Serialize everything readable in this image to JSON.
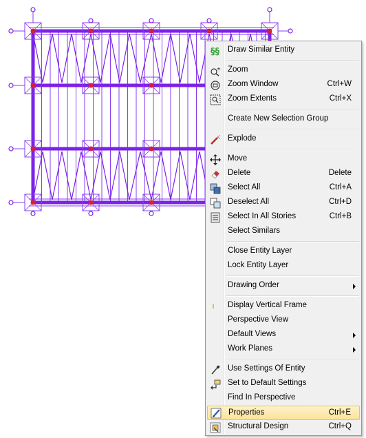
{
  "menu": {
    "draw_similar": "Draw Similar Entity",
    "zoom": "Zoom",
    "zoom_window": "Zoom Window",
    "zoom_window_sc": "Ctrl+W",
    "zoom_extents": "Zoom Extents",
    "zoom_extents_sc": "Ctrl+X",
    "create_group": "Create New Selection Group",
    "explode": "Explode",
    "move": "Move",
    "delete": "Delete",
    "delete_sc": "Delete",
    "select_all": "Select All",
    "select_all_sc": "Ctrl+A",
    "deselect_all": "Deselect All",
    "deselect_all_sc": "Ctrl+D",
    "select_stories": "Select In All Stories",
    "select_stories_sc": "Ctrl+B",
    "select_similars": "Select Similars",
    "close_layer": "Close Entity Layer",
    "lock_layer": "Lock Entity Layer",
    "drawing_order": "Drawing Order",
    "display_vframe": "Display Vertical Frame",
    "perspective_view": "Perspective View",
    "default_views": "Default Views",
    "work_planes": "Work Planes",
    "use_settings": "Use Settings Of Entity",
    "set_default": "Set to Default Settings",
    "find_perspective": "Find In Perspective",
    "properties": "Properties",
    "properties_sc": "Ctrl+E",
    "structural_design": "Structural Design",
    "structural_design_sc": "Ctrl+Q"
  },
  "colors": {
    "frame": "#7b22e6",
    "frame_thin": "#8a3cf0",
    "joint": "#d81e3c",
    "highlight": "#fbe39a"
  }
}
